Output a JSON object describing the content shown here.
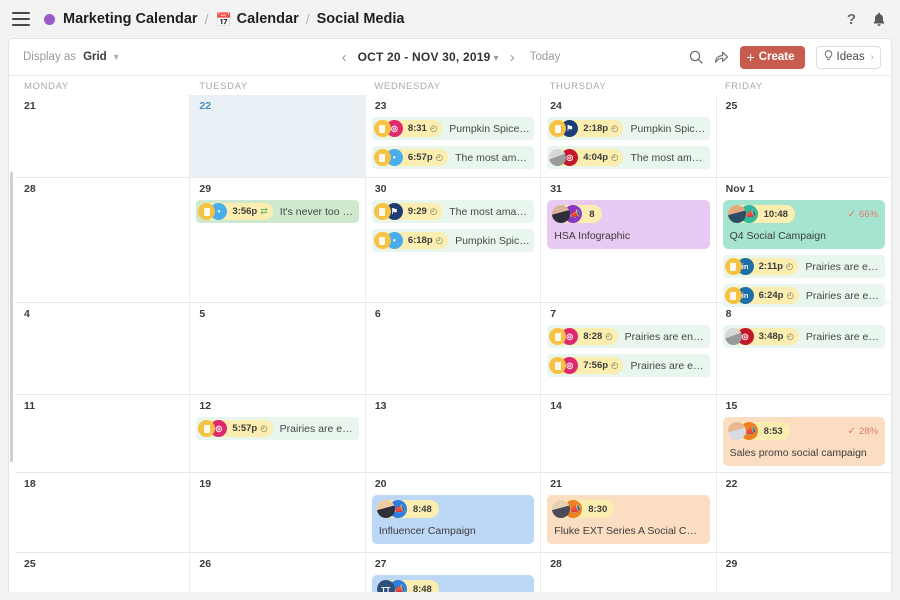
{
  "header": {
    "menu_icon": "hamburger-icon",
    "workspace": "Marketing Calendar",
    "sep": "/",
    "section": "Calendar",
    "view": "Social Media",
    "help_icon": "?",
    "bell_icon": "🔔",
    "accent": "#9b59c6"
  },
  "toolbar": {
    "display_as_label": "Display as",
    "display_as_value": "Grid",
    "prev": "‹",
    "next": "›",
    "range": "OCT 20 - NOV 30, 2019",
    "range_caret": "▾",
    "today": "Today",
    "search_icon": "search-icon",
    "share_icon": "share-icon",
    "create_label": "Create",
    "create_plus": "+",
    "create_color": "#c75c4e",
    "ideas_label": "Ideas",
    "ideas_icon": "lightbulb-icon",
    "ideas_caret": "›"
  },
  "calendar": {
    "weekdays": [
      "MONDAY",
      "TUESDAY",
      "WEDNESDAY",
      "THURSDAY",
      "FRIDAY"
    ],
    "weeks": [
      {
        "days": [
          {
            "num": "21",
            "today": false,
            "posts": [],
            "campaigns": []
          },
          {
            "num": "22",
            "today": true,
            "posts": [],
            "campaigns": []
          },
          {
            "num": "23",
            "today": false,
            "campaigns": [],
            "posts": [
              {
                "net": "instagram",
                "net_label": "◎",
                "avatar": "doc",
                "time": "8:31",
                "clock": "◴",
                "text": "Pumpkin Spice Fren…"
              },
              {
                "net": "twitter",
                "net_label": "•",
                "avatar": "doc",
                "time": "6:57p",
                "clock": "◴",
                "text": "The most amazing …"
              }
            ]
          },
          {
            "num": "24",
            "today": false,
            "campaigns": [],
            "posts": [
              {
                "net": "facebook",
                "net_label": "⚑",
                "avatar": "doc",
                "time": "2:18p",
                "clock": "◴",
                "text": "Pumpkin Spice Fre…"
              },
              {
                "net": "ig2",
                "net_label": "◎",
                "avatar": "photo2",
                "time": "4:04p",
                "clock": "◴",
                "text": "The most amazing …"
              }
            ]
          },
          {
            "num": "25",
            "today": false,
            "posts": [],
            "campaigns": []
          }
        ]
      },
      {
        "days": [
          {
            "num": "28",
            "today": false,
            "posts": [],
            "campaigns": []
          },
          {
            "num": "29",
            "today": false,
            "campaigns": [],
            "posts": [
              {
                "net": "twitter",
                "net_label": "•",
                "avatar": "doc",
                "time": "3:56p",
                "shuffle": "⇄",
                "text": "It's never too early to …",
                "style": "green"
              }
            ]
          },
          {
            "num": "30",
            "today": false,
            "campaigns": [],
            "posts": [
              {
                "net": "facebook",
                "net_label": "⚑",
                "avatar": "doc",
                "time": "9:29",
                "clock": "◴",
                "text": "The most amazing F…"
              },
              {
                "net": "twitter",
                "net_label": "•",
                "avatar": "doc",
                "time": "6:18p",
                "clock": "◴",
                "text": "Pumpkin Spice Fre…"
              }
            ]
          },
          {
            "num": "31",
            "today": false,
            "posts": [],
            "campaigns": [
              {
                "color": "purple",
                "avatar": "av-a",
                "net": "n-purple",
                "icon": "megaphone-icon",
                "count": "8",
                "title": "HSA Infographic"
              }
            ]
          },
          {
            "num": "Nov 1",
            "today": false,
            "campaigns": [
              {
                "color": "teal",
                "avatar": "av-b",
                "net": "n-teal",
                "icon": "megaphone-icon",
                "time": "10:48",
                "pct": "66%",
                "check": "✓",
                "title": "Q4 Social Campaign"
              }
            ],
            "posts": [
              {
                "net": "linkedin",
                "net_label": "in",
                "avatar": "doc",
                "time": "2:11p",
                "clock": "◴",
                "text": "Prairies are enormo…"
              },
              {
                "net": "linkedin",
                "net_label": "in",
                "avatar": "doc",
                "time": "6:24p",
                "clock": "◴",
                "text": "Prairies are enormo…"
              }
            ]
          }
        ]
      },
      {
        "days": [
          {
            "num": "4",
            "today": false,
            "posts": [],
            "campaigns": []
          },
          {
            "num": "5",
            "today": false,
            "posts": [],
            "campaigns": []
          },
          {
            "num": "6",
            "today": false,
            "posts": [],
            "campaigns": []
          },
          {
            "num": "7",
            "today": false,
            "campaigns": [],
            "posts": [
              {
                "net": "instagram",
                "net_label": "◎",
                "avatar": "doc",
                "time": "8:28",
                "clock": "◴",
                "text": "Prairies are enormou…"
              },
              {
                "net": "instagram",
                "net_label": "◎",
                "avatar": "doc",
                "time": "7:56p",
                "clock": "◴",
                "text": "Prairies are enormo…"
              }
            ]
          },
          {
            "num": "8",
            "today": false,
            "campaigns": [],
            "posts": [
              {
                "net": "ig2",
                "net_label": "◎",
                "avatar": "photo2",
                "time": "3:48p",
                "clock": "◴",
                "text": "Prairies are enormo…"
              }
            ]
          }
        ]
      },
      {
        "days": [
          {
            "num": "11",
            "today": false,
            "posts": [],
            "campaigns": []
          },
          {
            "num": "12",
            "today": false,
            "campaigns": [],
            "posts": [
              {
                "net": "instagram",
                "net_label": "◎",
                "avatar": "doc",
                "time": "5:57p",
                "clock": "◴",
                "text": "Prairies are enormo…"
              }
            ]
          },
          {
            "num": "13",
            "today": false,
            "posts": [],
            "campaigns": []
          },
          {
            "num": "14",
            "today": false,
            "posts": [],
            "campaigns": []
          },
          {
            "num": "15",
            "today": false,
            "posts": [],
            "campaigns": [
              {
                "color": "peach",
                "avatar": "av-c",
                "net": "n-orange",
                "icon": "megaphone-icon",
                "time": "8:53",
                "pct": "28%",
                "check": "✓",
                "title": "Sales promo social campaign"
              }
            ]
          }
        ]
      },
      {
        "days": [
          {
            "num": "18",
            "today": false,
            "posts": [],
            "campaigns": []
          },
          {
            "num": "19",
            "today": false,
            "posts": [],
            "campaigns": []
          },
          {
            "num": "20",
            "today": false,
            "posts": [],
            "campaigns": [
              {
                "color": "blue",
                "avatar": "av-d",
                "net": "n-blue",
                "icon": "megaphone-icon",
                "time": "8:48",
                "title": "Influencer Campaign"
              }
            ]
          },
          {
            "num": "21",
            "today": false,
            "posts": [],
            "campaigns": [
              {
                "color": "peach",
                "avatar": "av-e",
                "net": "n-orange",
                "icon": "megaphone-icon",
                "time": "8:30",
                "title": "Fluke EXT Series A Social Campaign"
              }
            ]
          },
          {
            "num": "22",
            "today": false,
            "posts": [],
            "campaigns": []
          }
        ]
      },
      {
        "days": [
          {
            "num": "25",
            "today": false,
            "posts": [],
            "campaigns": []
          },
          {
            "num": "26",
            "today": false,
            "posts": [],
            "campaigns": []
          },
          {
            "num": "27",
            "today": false,
            "posts": [],
            "campaigns": [
              {
                "color": "blue",
                "avatar": "av-tt",
                "initials": "TT",
                "net": "n-blue",
                "icon": "megaphone-icon",
                "time": "8:48",
                "title": ""
              }
            ]
          },
          {
            "num": "28",
            "today": false,
            "posts": [],
            "campaigns": []
          },
          {
            "num": "29",
            "today": false,
            "posts": [],
            "campaigns": []
          }
        ]
      }
    ]
  }
}
